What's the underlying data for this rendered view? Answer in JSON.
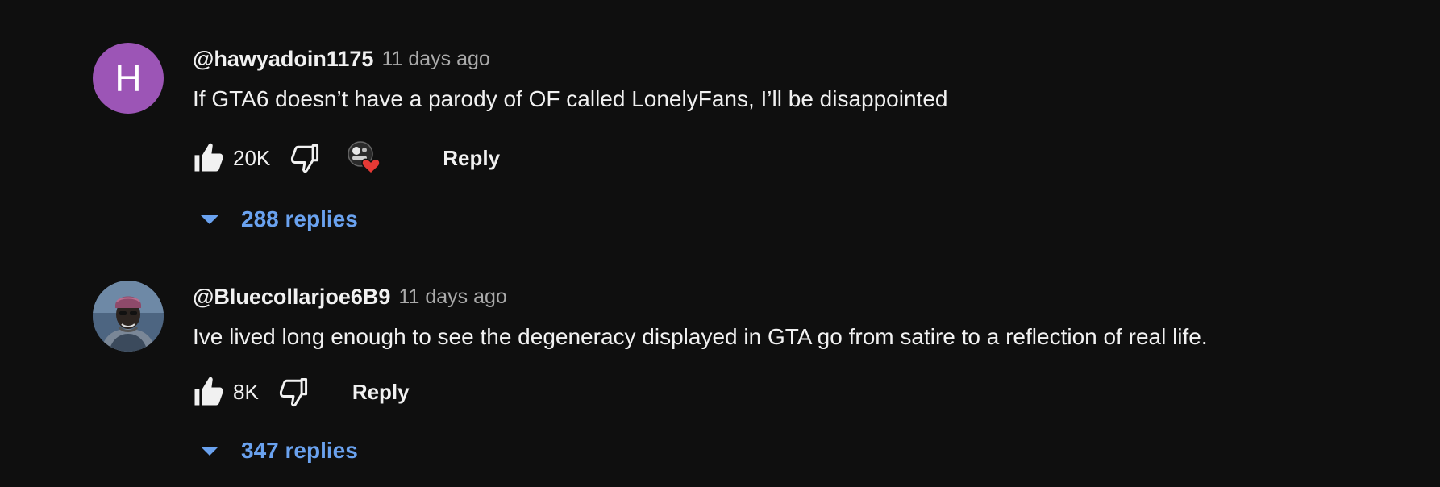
{
  "comments": [
    {
      "avatar_letter": "H",
      "avatar_color": "#9c55b6",
      "author": "@hawyadoin1175",
      "time": "11 days ago",
      "text": "If GTA6 doesn’t have a parody of OF called LonelyFans, I’ll be disappointed",
      "likes": "20K",
      "creator_heart": true,
      "reply_label": "Reply",
      "replies_label": "288 replies"
    },
    {
      "avatar_letter": "",
      "author": "@Bluecollarjoe6B9",
      "time": "11 days ago",
      "text": "Ive lived long enough to see the degeneracy displayed in  GTA go from satire to a reflection of real life.",
      "likes": "8K",
      "creator_heart": false,
      "reply_label": "Reply",
      "replies_label": "347 replies"
    }
  ],
  "icons": {
    "like": "thumbs-up-icon",
    "dislike": "thumbs-down-icon",
    "heart": "creator-heart-icon",
    "expand": "caret-down-icon"
  },
  "colors": {
    "background": "#0f0f0f",
    "link_blue": "#6aa2ef",
    "secondary_text": "#aaaaaa",
    "heart_red": "#e53935"
  }
}
